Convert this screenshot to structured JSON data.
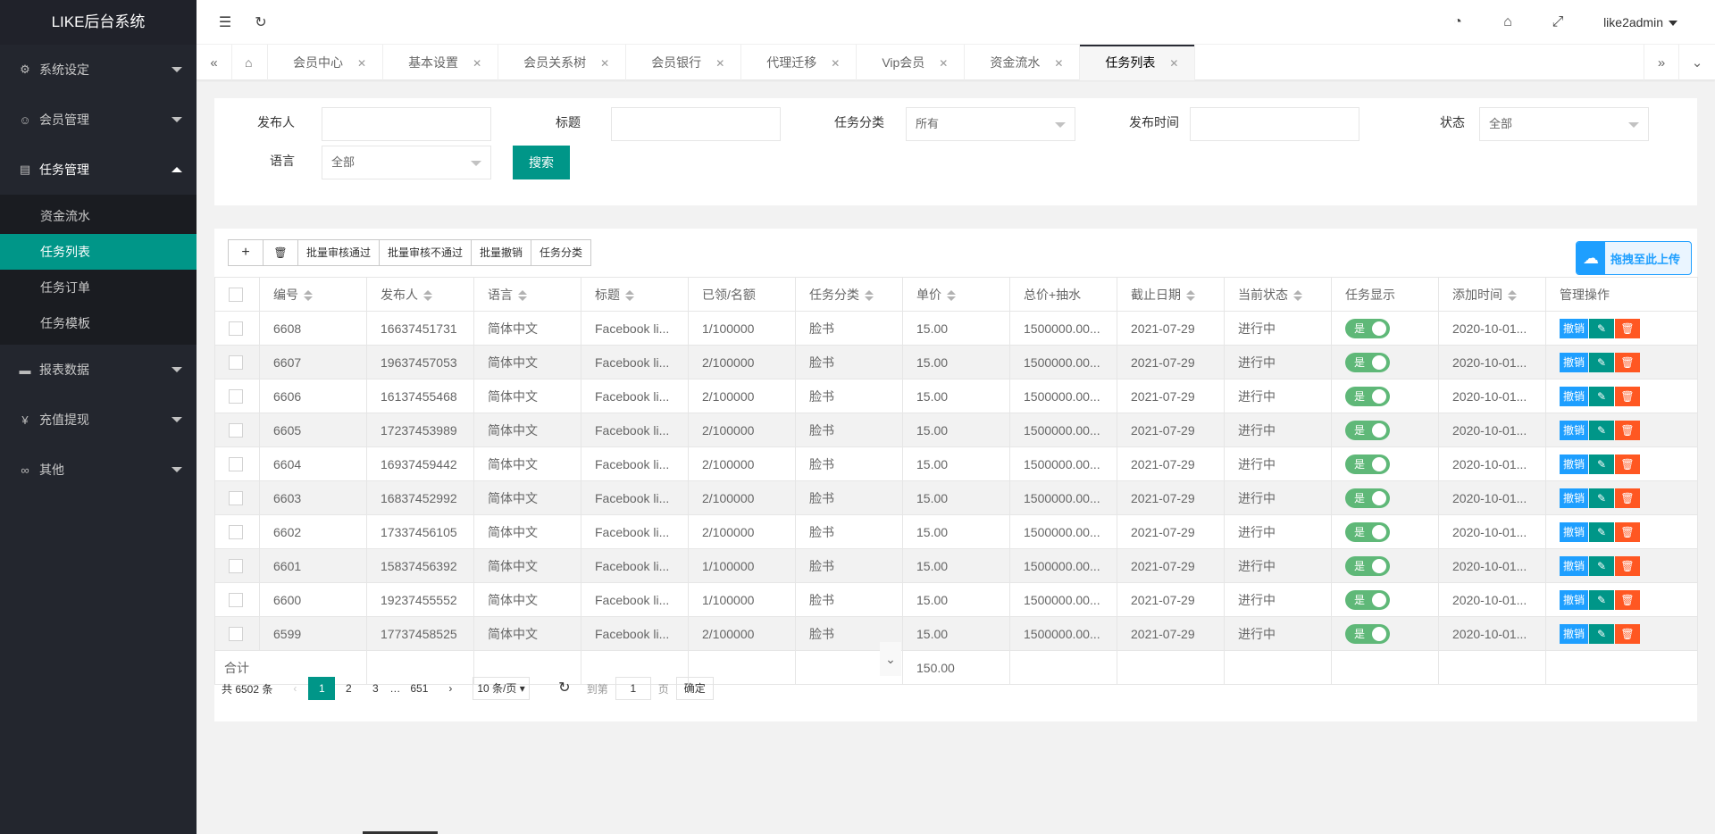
{
  "app": {
    "title": "LIKE后台系统",
    "user": "like2admin"
  },
  "sidebar": {
    "items": [
      {
        "label": "系统设定",
        "icon": "gear-icon"
      },
      {
        "label": "会员管理",
        "icon": "user-icon"
      },
      {
        "label": "任务管理",
        "icon": "document-icon"
      },
      {
        "label": "报表数据",
        "icon": "chat-icon"
      },
      {
        "label": "充值提现",
        "icon": "yen-icon"
      },
      {
        "label": "其他",
        "icon": "link-icon"
      }
    ],
    "sub_items": [
      "资金流水",
      "任务列表",
      "任务订单",
      "任务模板"
    ]
  },
  "tabs": [
    "会员中心",
    "基本设置",
    "会员关系树",
    "会员银行",
    "代理迁移",
    "Vip会员",
    "资金流水",
    "任务列表"
  ],
  "search": {
    "publisher_label": "发布人",
    "title_label": "标题",
    "category_label": "任务分类",
    "category_value": "所有",
    "time_label": "发布时间",
    "status_label": "状态",
    "status_value": "全部",
    "lang_label": "语言",
    "lang_value": "全部",
    "button": "搜索"
  },
  "toolbar": {
    "add": "+",
    "delete": "🗑",
    "approve": "批量审核通过",
    "reject": "批量审核不通过",
    "revoke": "批量撤销",
    "category": "任务分类",
    "upload": "拖拽至此上传"
  },
  "table": {
    "headers": [
      "编号",
      "发布人",
      "语言",
      "标题",
      "已领/名额",
      "任务分类",
      "单价",
      "总价+抽水",
      "截止日期",
      "当前状态",
      "任务显示",
      "添加时间",
      "管理操作"
    ],
    "rows": [
      [
        "6608",
        "16637451731",
        "简体中文",
        "Facebook li...",
        "1/100000",
        "脸书",
        "15.00",
        "1500000.00...",
        "2021-07-29",
        "进行中",
        "是",
        "2020-10-01..."
      ],
      [
        "6607",
        "19637457053",
        "简体中文",
        "Facebook li...",
        "2/100000",
        "脸书",
        "15.00",
        "1500000.00...",
        "2021-07-29",
        "进行中",
        "是",
        "2020-10-01..."
      ],
      [
        "6606",
        "16137455468",
        "简体中文",
        "Facebook li...",
        "2/100000",
        "脸书",
        "15.00",
        "1500000.00...",
        "2021-07-29",
        "进行中",
        "是",
        "2020-10-01..."
      ],
      [
        "6605",
        "17237453989",
        "简体中文",
        "Facebook li...",
        "2/100000",
        "脸书",
        "15.00",
        "1500000.00...",
        "2021-07-29",
        "进行中",
        "是",
        "2020-10-01..."
      ],
      [
        "6604",
        "16937459442",
        "简体中文",
        "Facebook li...",
        "2/100000",
        "脸书",
        "15.00",
        "1500000.00...",
        "2021-07-29",
        "进行中",
        "是",
        "2020-10-01..."
      ],
      [
        "6603",
        "16837452992",
        "简体中文",
        "Facebook li...",
        "2/100000",
        "脸书",
        "15.00",
        "1500000.00...",
        "2021-07-29",
        "进行中",
        "是",
        "2020-10-01..."
      ],
      [
        "6602",
        "17337456105",
        "简体中文",
        "Facebook li...",
        "2/100000",
        "脸书",
        "15.00",
        "1500000.00...",
        "2021-07-29",
        "进行中",
        "是",
        "2020-10-01..."
      ],
      [
        "6601",
        "15837456392",
        "简体中文",
        "Facebook li...",
        "1/100000",
        "脸书",
        "15.00",
        "1500000.00...",
        "2021-07-29",
        "进行中",
        "是",
        "2020-10-01..."
      ],
      [
        "6600",
        "19237455552",
        "简体中文",
        "Facebook li...",
        "1/100000",
        "脸书",
        "15.00",
        "1500000.00...",
        "2021-07-29",
        "进行中",
        "是",
        "2020-10-01..."
      ],
      [
        "6599",
        "17737458525",
        "简体中文",
        "Facebook li...",
        "2/100000",
        "脸书",
        "15.00",
        "1500000.00...",
        "2021-07-29",
        "进行中",
        "是",
        "2020-10-01..."
      ]
    ],
    "ops": {
      "revoke": "撤销",
      "edit": "✎",
      "delete": "🗑"
    },
    "sum_label": "合计",
    "sum_price": "150.00"
  },
  "pager": {
    "total": "共 6502 条",
    "pages": [
      "1",
      "2",
      "3",
      "…",
      "651"
    ],
    "per_page": "10 条/页",
    "goto": "到第",
    "goto_value": "1",
    "page_unit": "页",
    "confirm": "确定"
  }
}
